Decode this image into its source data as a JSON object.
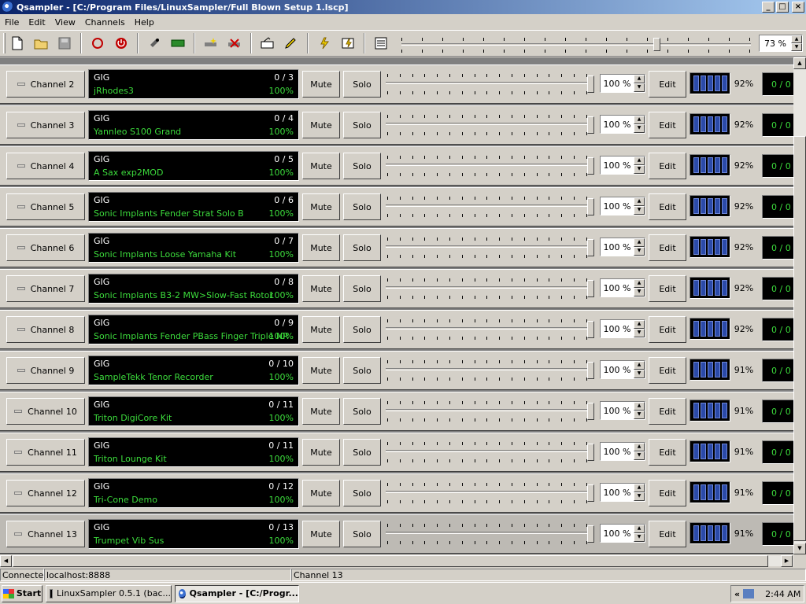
{
  "window": {
    "title": "Qsampler - [C:/Program Files/LinuxSampler/Full Blown Setup 1.lscp]",
    "controls": {
      "minimize": "_",
      "maximize": "□",
      "close": "×"
    }
  },
  "menu": [
    "File",
    "Edit",
    "View",
    "Channels",
    "Help"
  ],
  "toolbar": {
    "icons": [
      "new-file-icon",
      "open-folder-icon",
      "save-icon",
      "record-icon",
      "power-icon",
      "instrument-icon",
      "device-icon",
      "add-channel-icon",
      "remove-channel-icon",
      "channel-setup-icon",
      "edit-channel-icon",
      "reset-icon",
      "reset-all-icon",
      "options-icon"
    ],
    "zoom_value": "73 %",
    "zoom_level": 0.73
  },
  "channels": [
    {
      "label": "Channel 2",
      "engine": "GIG",
      "instrument": "jRhodes3",
      "voices": "0 / 3",
      "load": "100%",
      "mute": "Mute",
      "solo": "Solo",
      "volume": "100 %",
      "edit": "Edit",
      "meter_pct": "92%",
      "streams": "0 / 0"
    },
    {
      "label": "Channel 3",
      "engine": "GIG",
      "instrument": "Yannleo S100 Grand",
      "voices": "0 / 4",
      "load": "100%",
      "mute": "Mute",
      "solo": "Solo",
      "volume": "100 %",
      "edit": "Edit",
      "meter_pct": "92%",
      "streams": "0 / 0"
    },
    {
      "label": "Channel 4",
      "engine": "GIG",
      "instrument": "A Sax exp2MOD",
      "voices": "0 / 5",
      "load": "100%",
      "mute": "Mute",
      "solo": "Solo",
      "volume": "100 %",
      "edit": "Edit",
      "meter_pct": "92%",
      "streams": "0 / 0"
    },
    {
      "label": "Channel 5",
      "engine": "GIG",
      "instrument": "Sonic Implants Fender Strat Solo B",
      "voices": "0 / 6",
      "load": "100%",
      "mute": "Mute",
      "solo": "Solo",
      "volume": "100 %",
      "edit": "Edit",
      "meter_pct": "92%",
      "streams": "0 / 0"
    },
    {
      "label": "Channel 6",
      "engine": "GIG",
      "instrument": "Sonic Implants Loose Yamaha Kit",
      "voices": "0 / 7",
      "load": "100%",
      "mute": "Mute",
      "solo": "Solo",
      "volume": "100 %",
      "edit": "Edit",
      "meter_pct": "92%",
      "streams": "0 / 0"
    },
    {
      "label": "Channel 7",
      "engine": "GIG",
      "instrument": "Sonic Implants B3-2 MW>Slow-Fast Rotor",
      "voices": "0 / 8",
      "load": "100%",
      "mute": "Mute",
      "solo": "Solo",
      "volume": "100 %",
      "edit": "Edit",
      "meter_pct": "92%",
      "streams": "0 / 0"
    },
    {
      "label": "Channel 8",
      "engine": "GIG",
      "instrument": "Sonic Implants Fender PBass Finger Triple NR",
      "voices": "0 / 9",
      "load": "100%",
      "mute": "Mute",
      "solo": "Solo",
      "volume": "100 %",
      "edit": "Edit",
      "meter_pct": "92%",
      "streams": "0 / 0"
    },
    {
      "label": "Channel 9",
      "engine": "GIG",
      "instrument": "SampleTekk Tenor Recorder",
      "voices": "0 / 10",
      "load": "100%",
      "mute": "Mute",
      "solo": "Solo",
      "volume": "100 %",
      "edit": "Edit",
      "meter_pct": "91%",
      "streams": "0 / 0"
    },
    {
      "label": "Channel 10",
      "engine": "GIG",
      "instrument": "Triton DigiCore Kit",
      "voices": "0 / 11",
      "load": "100%",
      "mute": "Mute",
      "solo": "Solo",
      "volume": "100 %",
      "edit": "Edit",
      "meter_pct": "91%",
      "streams": "0 / 0"
    },
    {
      "label": "Channel 11",
      "engine": "GIG",
      "instrument": "Triton Lounge Kit",
      "voices": "0 / 11",
      "load": "100%",
      "mute": "Mute",
      "solo": "Solo",
      "volume": "100 %",
      "edit": "Edit",
      "meter_pct": "91%",
      "streams": "0 / 0"
    },
    {
      "label": "Channel 12",
      "engine": "GIG",
      "instrument": "Tri-Cone Demo",
      "voices": "0 / 12",
      "load": "100%",
      "mute": "Mute",
      "solo": "Solo",
      "volume": "100 %",
      "edit": "Edit",
      "meter_pct": "91%",
      "streams": "0 / 0"
    },
    {
      "label": "Channel 13",
      "engine": "GIG",
      "instrument": "Trumpet Vib Sus",
      "voices": "0 / 13",
      "load": "100%",
      "mute": "Mute",
      "solo": "Solo",
      "volume": "100 %",
      "edit": "Edit",
      "meter_pct": "91%",
      "streams": "0 / 0",
      "active": true
    }
  ],
  "status": {
    "connection": "Connected",
    "host": "localhost:8888",
    "channel": "Channel 13"
  },
  "taskbar": {
    "start": "Start",
    "tasks": [
      "LinuxSampler 0.5.1 (bac...",
      "Qsampler - [C:/Progr..."
    ],
    "tray_chevron": "«",
    "clock": "2:44 AM"
  },
  "colors": {
    "title_start": "#0a246a",
    "title_end": "#a6caf0",
    "lcd_green": "#3cdc3c",
    "meter_blue": "#2b4aa8"
  }
}
